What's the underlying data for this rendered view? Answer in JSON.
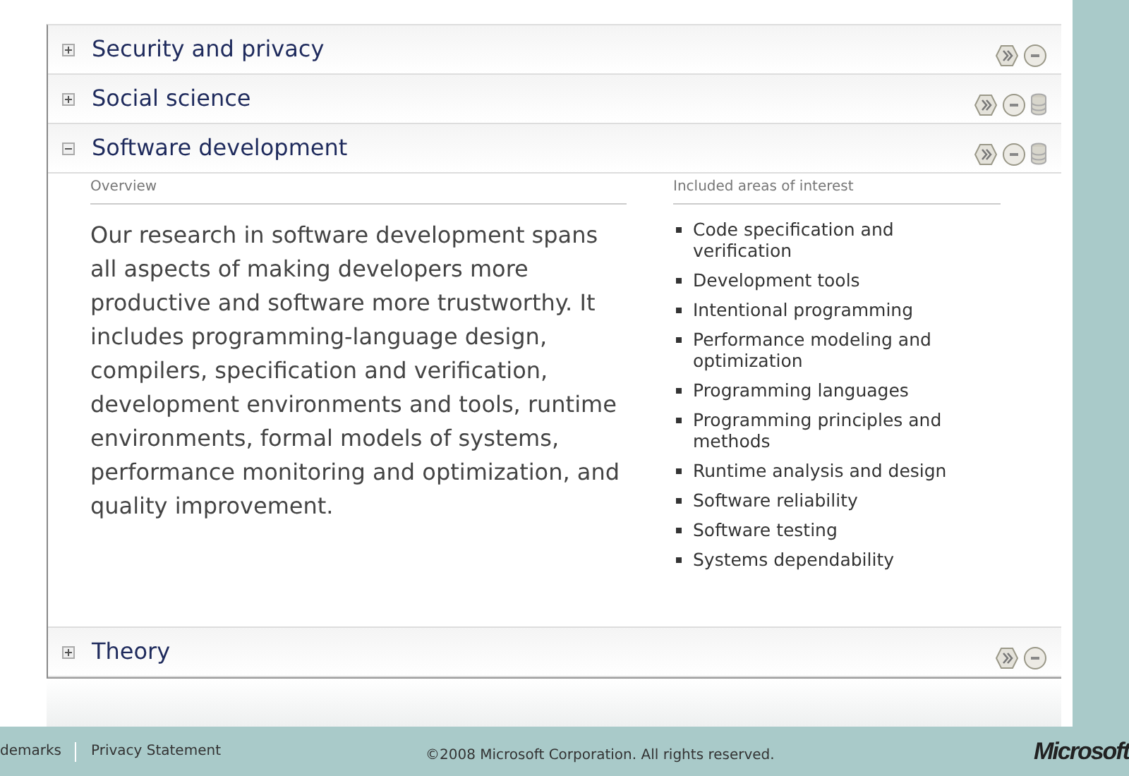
{
  "sections": [
    {
      "title": "Security and privacy",
      "expanded": false,
      "icons": [
        {
          "kind": "hexagon"
        },
        {
          "kind": "circle"
        }
      ]
    },
    {
      "title": "Social science",
      "expanded": false,
      "icons": [
        {
          "kind": "hexagon"
        },
        {
          "kind": "circle"
        },
        {
          "kind": "stack"
        }
      ]
    },
    {
      "title": "Software development",
      "expanded": true,
      "icons": [
        {
          "kind": "hexagon"
        },
        {
          "kind": "circle"
        },
        {
          "kind": "stack"
        }
      ],
      "overview_label": "Overview",
      "overview": "Our research in software development spans all aspects of making developers more productive and software more trustworthy. It includes programming-language design, compilers, specification and verification, development environments and tools, runtime environments, formal models of systems, performance monitoring and optimization, and quality improvement.",
      "areas_label": "Included areas of interest",
      "areas": [
        "Code specification and verification",
        "Development tools",
        "Intentional programming",
        "Performance modeling and optimization",
        "Programming languages",
        "Programming principles and methods",
        "Runtime analysis and design",
        "Software reliability",
        "Software testing",
        "Systems dependability"
      ]
    },
    {
      "title": "Theory",
      "expanded": false,
      "icons": [
        {
          "kind": "hexagon"
        },
        {
          "kind": "circle"
        }
      ]
    }
  ],
  "footer": {
    "links": [
      "demarks",
      "Privacy Statement"
    ],
    "copyright": "©2008 Microsoft Corporation. All rights reserved.",
    "logo": "Microsoft"
  }
}
